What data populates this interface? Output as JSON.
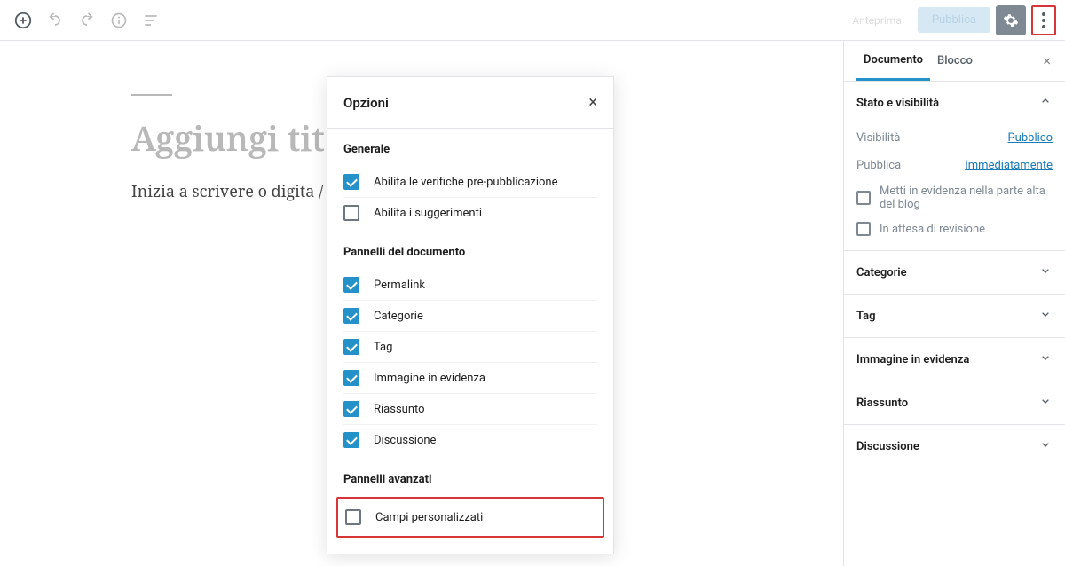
{
  "toolbar": {
    "draft_btn": "Anteprima",
    "publish_btn": "Pubblica"
  },
  "editor": {
    "title_placeholder": "Aggiungi tit",
    "body_placeholder": "Inizia a scrivere o digita / p"
  },
  "sidebar": {
    "tabs": {
      "document": "Documento",
      "block": "Blocco"
    },
    "status": {
      "header": "Stato e visibilità",
      "visibility_label": "Visibilità",
      "visibility_value": "Pubblico",
      "publish_label": "Pubblica",
      "publish_value": "Immediatamente",
      "featured_label": "Metti in evidenza nella parte alta del blog",
      "pending_label": "In attesa di revisione"
    },
    "panels": {
      "categories": "Categorie",
      "tags": "Tag",
      "featured_image": "Immagine in evidenza",
      "excerpt": "Riassunto",
      "discussion": "Discussione"
    }
  },
  "modal": {
    "title": "Opzioni",
    "sections": {
      "general": "Generale",
      "doc_panels": "Pannelli del documento",
      "advanced_panels": "Pannelli avanzati"
    },
    "options": {
      "prepub": "Abilita le verifiche pre-pubblicazione",
      "tips": "Abilita i suggerimenti",
      "permalink": "Permalink",
      "categories": "Categorie",
      "tags": "Tag",
      "featured": "Immagine in evidenza",
      "excerpt": "Riassunto",
      "discussion": "Discussione",
      "custom_fields": "Campi personalizzati"
    }
  }
}
